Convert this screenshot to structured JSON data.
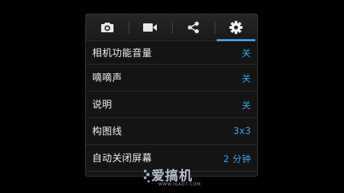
{
  "tabs": [
    {
      "name": "camera-icon"
    },
    {
      "name": "video-icon"
    },
    {
      "name": "share-icon"
    },
    {
      "name": "gear-icon",
      "active": true
    }
  ],
  "settings": [
    {
      "label": "相机功能音量",
      "value": "关"
    },
    {
      "label": "嘀嘀声",
      "value": "关"
    },
    {
      "label": "说明",
      "value": "关"
    },
    {
      "label": "构图线",
      "value": "3x3"
    },
    {
      "label": "自动关闭屏幕",
      "value": "2 分钟"
    }
  ],
  "watermark": {
    "logo_text": "爱搞机",
    "url_text": "WWW.IGAO7.COM"
  },
  "colors": {
    "accent": "#3ea6ec",
    "background": "#000000",
    "panel": "#141414"
  }
}
